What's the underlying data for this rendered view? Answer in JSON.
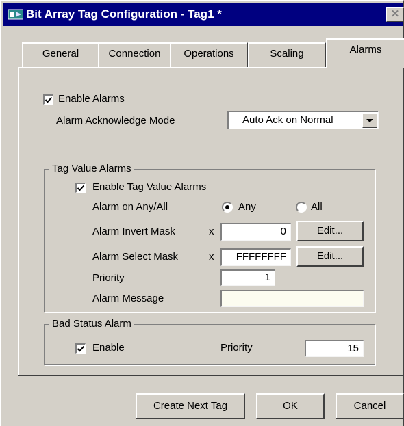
{
  "window": {
    "title": "Bit Array Tag Configuration - Tag1 *",
    "close_glyph": "✕"
  },
  "tabs": [
    {
      "label": "General"
    },
    {
      "label": "Connection"
    },
    {
      "label": "Operations"
    },
    {
      "label": "Scaling"
    },
    {
      "label": "Alarms",
      "active": true
    }
  ],
  "alarms": {
    "enable_alarms": {
      "label": "Enable Alarms",
      "checked": true
    },
    "ack_mode": {
      "label": "Alarm Acknowledge Mode",
      "value": "Auto Ack on Normal"
    }
  },
  "tag_value_alarms": {
    "group_label": "Tag Value Alarms",
    "enable": {
      "label": "Enable Tag Value Alarms",
      "checked": true
    },
    "any_all": {
      "label": "Alarm on Any/All",
      "options": [
        "Any",
        "All"
      ],
      "selected": "Any"
    },
    "invert_mask": {
      "label": "Alarm Invert Mask",
      "prefix": "x",
      "value": "0",
      "edit_label": "Edit..."
    },
    "select_mask": {
      "label": "Alarm Select Mask",
      "prefix": "x",
      "value": "FFFFFFFF",
      "edit_label": "Edit..."
    },
    "priority": {
      "label": "Priority",
      "value": "1"
    },
    "message": {
      "label": "Alarm Message",
      "value": ""
    }
  },
  "bad_status_alarm": {
    "group_label": "Bad Status Alarm",
    "enable": {
      "label": "Enable",
      "checked": true
    },
    "priority": {
      "label": "Priority",
      "value": "15"
    }
  },
  "footer": {
    "create_next": "Create Next Tag",
    "ok": "OK",
    "cancel": "Cancel"
  },
  "colors": {
    "titlebar": "#000080",
    "face": "#d4d0c8",
    "message_field": "#fcfcf0"
  }
}
